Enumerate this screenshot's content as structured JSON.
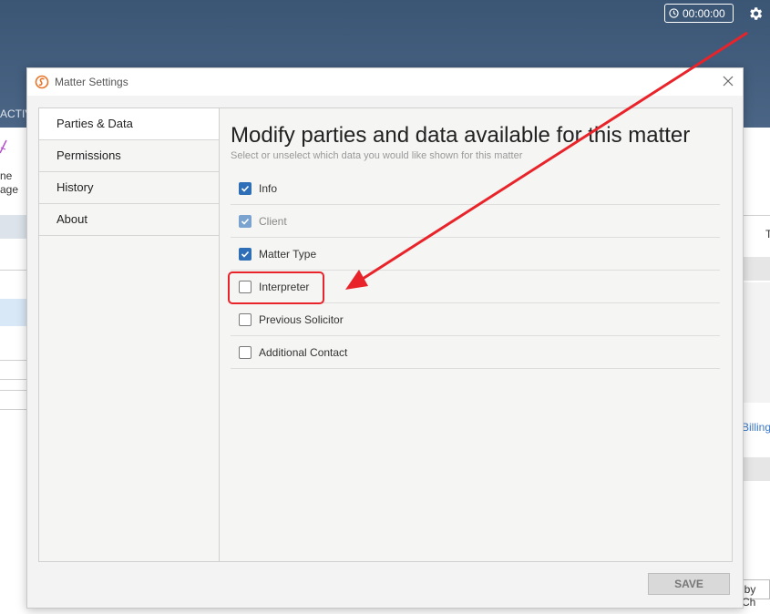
{
  "header": {
    "timer": "00:00:00",
    "icons": {
      "clock": "clock-icon",
      "settings": "gear-icon"
    }
  },
  "background": {
    "tab_fragment": "ACTIV",
    "left_labels": [
      "ne",
      "age"
    ],
    "right_letter": "T",
    "right_link": "Billing",
    "right_bottom": "lby Ch"
  },
  "dialog": {
    "title": "Matter Settings",
    "nav": [
      {
        "label": "Parties & Data",
        "active": true
      },
      {
        "label": "Permissions",
        "active": false
      },
      {
        "label": "History",
        "active": false
      },
      {
        "label": "About",
        "active": false
      }
    ],
    "heading": "Modify parties and data available for this matter",
    "subheading": "Select or unselect which data you would like shown for this matter",
    "items": [
      {
        "label": "Info",
        "checked": true,
        "disabled": false
      },
      {
        "label": "Client",
        "checked": true,
        "disabled": true
      },
      {
        "label": "Matter Type",
        "checked": true,
        "disabled": false
      },
      {
        "label": "Interpreter",
        "checked": false,
        "disabled": false
      },
      {
        "label": "Previous Solicitor",
        "checked": false,
        "disabled": false
      },
      {
        "label": "Additional Contact",
        "checked": false,
        "disabled": false
      }
    ],
    "save_label": "SAVE"
  },
  "colors": {
    "header": "#3b5575",
    "accent": "#2f6fb7",
    "annotation": "#e8242a"
  }
}
